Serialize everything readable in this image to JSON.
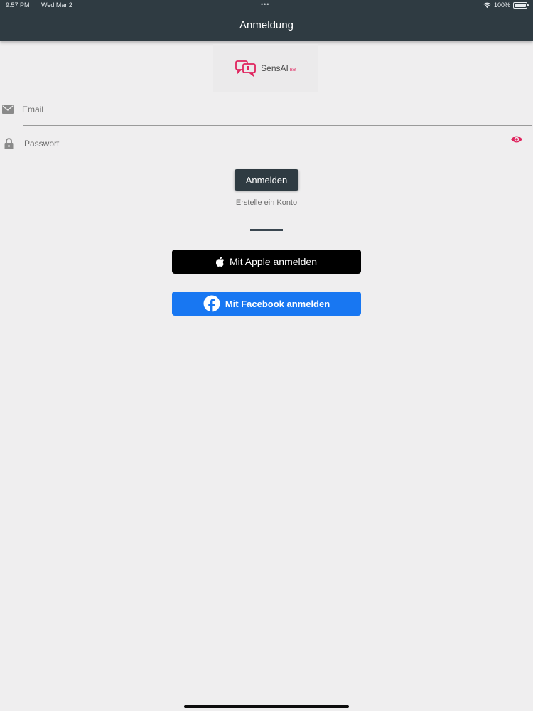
{
  "status_bar": {
    "time": "9:57 PM",
    "date": "Wed Mar 2",
    "dots": "•••",
    "battery": "100%"
  },
  "header": {
    "title": "Anmeldung"
  },
  "logo": {
    "name": "SensAI",
    "suffix": "Bot"
  },
  "form": {
    "email_label": "Email",
    "password_label": "Passwort",
    "submit_label": "Anmelden",
    "register_label": "Erstelle ein Konto"
  },
  "social": {
    "apple_label": "Mit Apple anmelden",
    "facebook_label": "Mit Facebook anmelden"
  },
  "colors": {
    "header_bg": "#2f3b42",
    "accent": "#e0245e",
    "facebook_blue": "#1877f2",
    "apple_black": "#000000"
  },
  "icons": [
    "wifi-icon",
    "battery-icon",
    "chat-logo-icon",
    "mail-icon",
    "lock-icon",
    "eye-icon",
    "apple-icon",
    "facebook-icon"
  ]
}
